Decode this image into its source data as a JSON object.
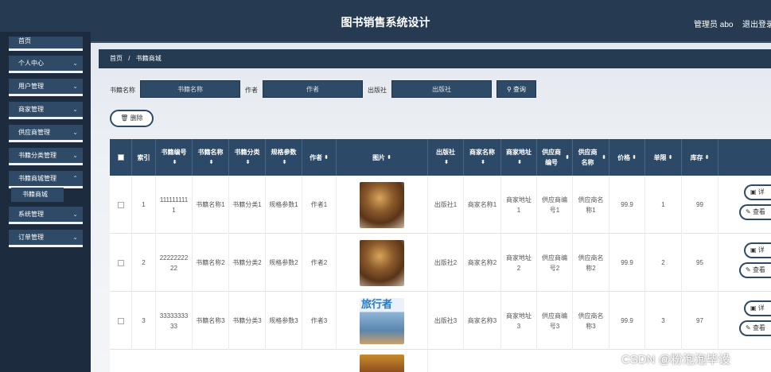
{
  "header": {
    "title": "图书销售系统设计",
    "admin": "管理员 abo",
    "logout": "退出登录"
  },
  "sidebar": {
    "items": [
      {
        "label": "首页"
      },
      {
        "label": "个人中心"
      },
      {
        "label": "用户管理"
      },
      {
        "label": "商家管理"
      },
      {
        "label": "供应商管理"
      },
      {
        "label": "书籍分类管理"
      },
      {
        "label": "书籍商城管理"
      },
      {
        "label": "系统管理"
      },
      {
        "label": "订单管理"
      }
    ],
    "sub_item": "书籍商城"
  },
  "breadcrumb": {
    "home": "首页",
    "sep": "/",
    "current": "书籍商城"
  },
  "search": {
    "name_label": "书籍名称",
    "name_placeholder": "书籍名称",
    "author_label": "作者",
    "author_placeholder": "作者",
    "publisher_label": "出版社",
    "publisher_placeholder": "出版社",
    "query_button": "查询"
  },
  "delete_button": "删除",
  "table": {
    "headers": [
      "索引",
      "书籍编号",
      "书籍名称",
      "书籍分类",
      "规格参数",
      "作者",
      "图片",
      "出版社",
      "商家名称",
      "商家地址",
      "供应商编号",
      "供应商名称",
      "价格",
      "单限",
      "库存"
    ],
    "rows": [
      {
        "index": "1",
        "code": "1111111111",
        "name": "书籍名称1",
        "category": "书籍分类1",
        "spec": "规格参数1",
        "author": "作者1",
        "image": "book",
        "publisher": "出版社1",
        "merchant": "商家名称1",
        "address": "商家地址1",
        "supplier_no": "供应商编号1",
        "supplier_name": "供应商名称1",
        "price": "99.9",
        "limit": "1",
        "stock": "99"
      },
      {
        "index": "2",
        "code": "2222222222",
        "name": "书籍名称2",
        "category": "书籍分类2",
        "spec": "规格参数2",
        "author": "作者2",
        "image": "book",
        "publisher": "出版社2",
        "merchant": "商家名称2",
        "address": "商家地址2",
        "supplier_no": "供应商编号2",
        "supplier_name": "供应商名称2",
        "price": "99.9",
        "limit": "2",
        "stock": "95"
      },
      {
        "index": "3",
        "code": "3333333333",
        "name": "书籍名称3",
        "category": "书籍分类3",
        "spec": "规格参数3",
        "author": "作者3",
        "image": "magazine",
        "publisher": "出版社3",
        "merchant": "商家名称3",
        "address": "商家地址3",
        "supplier_no": "供应商编号3",
        "supplier_name": "供应商名称3",
        "price": "99.9",
        "limit": "3",
        "stock": "97"
      }
    ],
    "magazine_title": "旅行者",
    "action_detail": "详",
    "action_view": "查看"
  },
  "watermark": "CSDN @粉泡泡毕设"
}
